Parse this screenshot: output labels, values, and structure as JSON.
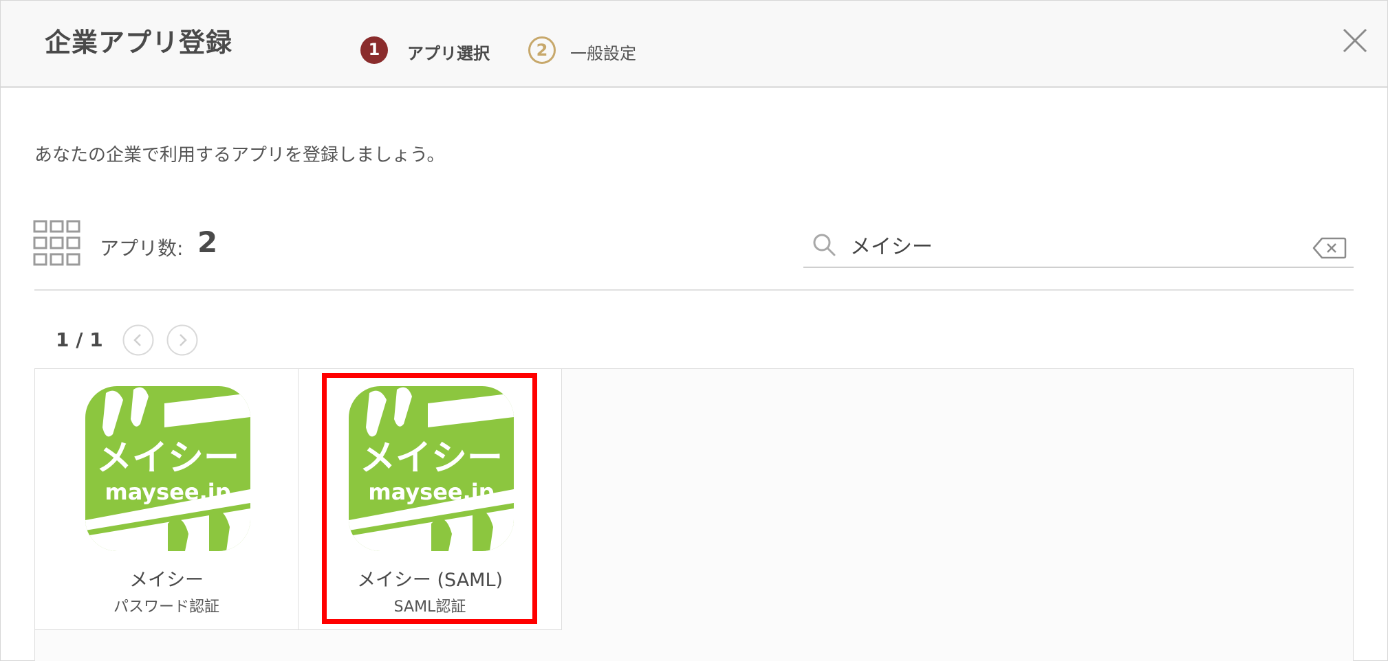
{
  "dialog": {
    "title": "企業アプリ登録",
    "steps": [
      {
        "number": "1",
        "label": "アプリ選択",
        "state": "active"
      },
      {
        "number": "2",
        "label": "一般設定",
        "state": "upcoming"
      }
    ],
    "close_icon": "close-icon"
  },
  "intro": "あなたの企業で利用するアプリを登録しましょう。",
  "toolbar": {
    "count_label": "アプリ数:",
    "count_value": "2",
    "search_value": "メイシー"
  },
  "pagination": {
    "text": "1 / 1"
  },
  "apps": [
    {
      "name": "メイシー",
      "auth": "パスワード認証",
      "logo_line1": "メイシー",
      "logo_line2": "maysee.jp",
      "selected": false
    },
    {
      "name": "メイシー (SAML)",
      "auth": "SAML認証",
      "logo_line1": "メイシー",
      "logo_line2": "maysee.jp",
      "selected": true
    }
  ],
  "colors": {
    "step_active": "#8a2c2c",
    "step_upcoming": "#c7a86b",
    "logo_green": "#8cc63f",
    "highlight": "#ff0000"
  }
}
